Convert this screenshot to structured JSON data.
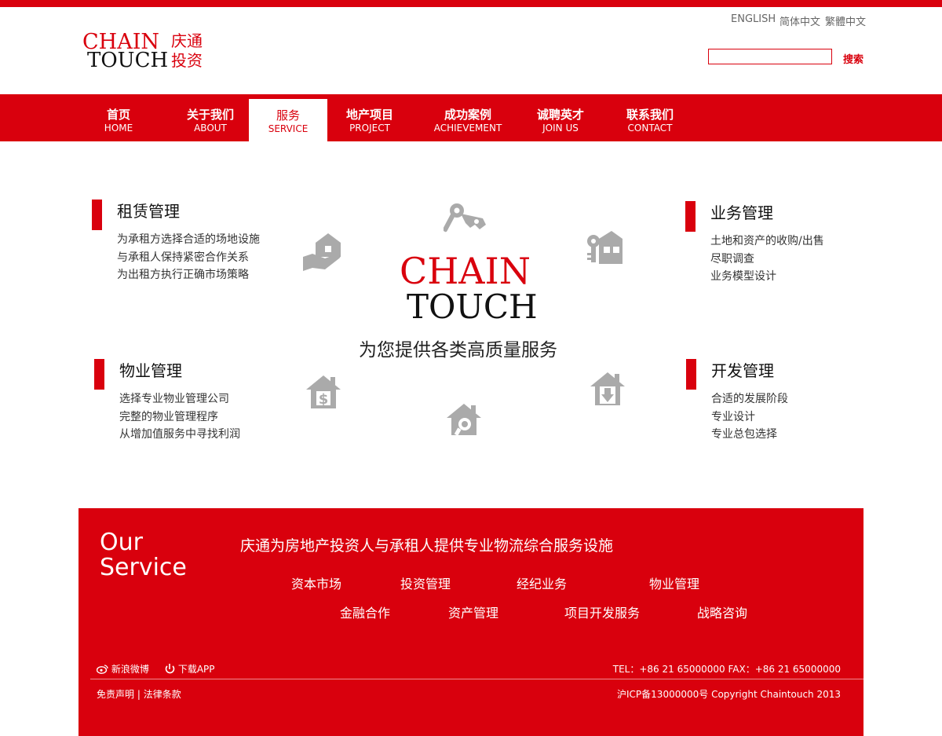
{
  "header": {
    "logo": {
      "en_line1": "CHAIN",
      "en_line2": "TOUCH",
      "cn_line1": "庆通",
      "cn_line2": "投资"
    },
    "languages": [
      "ENGLISH",
      "简体中文",
      "繁體中文"
    ],
    "search": {
      "value": "",
      "button_label": "搜索"
    }
  },
  "nav": {
    "items": [
      {
        "cn": "首页",
        "en": "HOME"
      },
      {
        "cn": "关于我们",
        "en": "ABOUT"
      },
      {
        "cn": "服务",
        "en": "SERVICE"
      },
      {
        "cn": "地产项目",
        "en": "PROJECT"
      },
      {
        "cn": "成功案例",
        "en": "ACHIEVEMENT"
      },
      {
        "cn": "诚聘英才",
        "en": "JOIN US"
      },
      {
        "cn": "联系我们",
        "en": "CONTACT"
      }
    ],
    "active": "SERVICE"
  },
  "services": {
    "leasing": {
      "title": "租赁管理",
      "lines": [
        "为承租方选择合适的场地设施",
        "与承租人保持紧密合作关系",
        "为出租方执行正确市场策略"
      ]
    },
    "business": {
      "title": "业务管理",
      "lines": [
        "土地和资产的收购/出售",
        "尽职调查",
        "业务模型设计"
      ]
    },
    "property": {
      "title": "物业管理",
      "lines": [
        "选择专业物业管理公司",
        "完整的物业管理程序",
        "从增加值服务中寻找利润"
      ]
    },
    "development": {
      "title": "开发管理",
      "lines": [
        "合适的发展阶段",
        "专业设计",
        "专业总包选择"
      ]
    }
  },
  "center": {
    "logo_line1": "CHAIN",
    "logo_line2": "TOUCH",
    "tagline": "为您提供各类高质量服务",
    "icons": [
      "keys-icon",
      "house-lock-icon",
      "house-in-hand-icon",
      "house-dollar-icon",
      "house-search-icon",
      "house-download-icon"
    ]
  },
  "footer": {
    "our_service_line1": "Our",
    "our_service_line2": "Service",
    "headline": "庆通为房地产投资人与承租人提供专业物流综合服务设施",
    "links_row1": [
      "资本市场",
      "投资管理",
      "经纪业务",
      "物业管理"
    ],
    "links_row2": [
      "金融合作",
      "资产管理",
      "项目开发服务",
      "战略咨询"
    ],
    "weibo": "新浪微博",
    "app": "下载APP",
    "contact": "TEL：+86 21 65000000  FAX：+86 21 65000000",
    "legal_disclaimer": "免责声明",
    "legal_terms": "法律条款",
    "copyright": "沪ICP备13000000号  Copyright Chaintouch 2013"
  },
  "colors": {
    "brand_red": "#d9000d",
    "icon_gray": "#aaaaaa"
  }
}
